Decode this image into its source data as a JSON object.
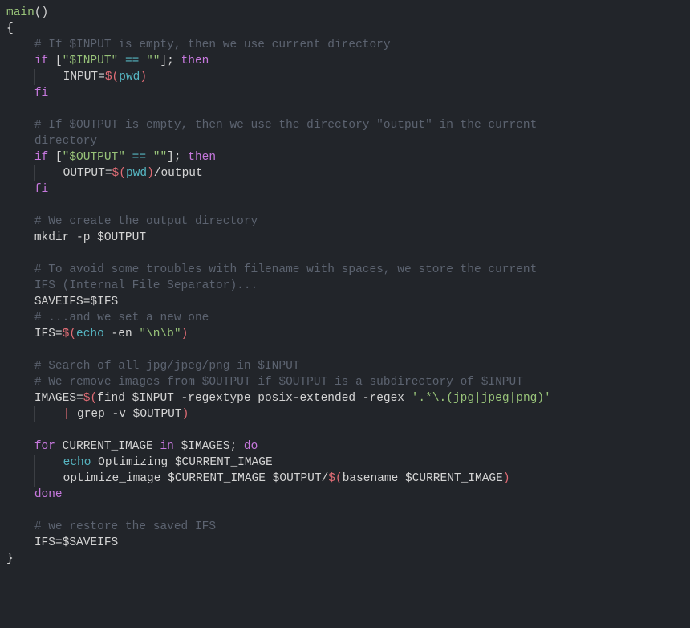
{
  "code": {
    "fn_name": "main",
    "c1": "# If $INPUT is empty, then we use current directory",
    "if": "if",
    "fi": "fi",
    "then": "then",
    "done": "done",
    "for": "for",
    "in": "in",
    "do": "do",
    "echo": "echo",
    "cond1_open": "[",
    "cond1_var": "\"$INPUT\"",
    "cond1_eq": " == ",
    "cond1_rhs": "\"\"",
    "cond1_close": "];",
    "line_input_assign_lhs": "INPUT=",
    "subst_open": "$(",
    "subst_close": ")",
    "pwd": "pwd",
    "c2a": "# If $OUTPUT is empty, then we use the directory \"output\" in the current ",
    "c2b": "directory",
    "cond2_var": "\"$OUTPUT\"",
    "line_output_assign_lhs": "OUTPUT=",
    "line_output_tail": "/output",
    "c3": "# We create the output directory",
    "mkdir": "mkdir -p $OUTPUT",
    "c4a": "# To avoid some troubles with filename with spaces, we store the current ",
    "c4b": "IFS (Internal File Separator)...",
    "saveifs": "SAVEIFS=$IFS",
    "c5": "# ...and we set a new one",
    "ifs_lhs": "IFS=",
    "ifs_flags": " -en ",
    "ifs_str": "\"\\n\\b\"",
    "c6": "# Search of all jpg/jpeg/png in $INPUT",
    "c7": "# We remove images from $OUTPUT if $OUTPUT is a subdirectory of $INPUT",
    "images_lhs": "IMAGES=",
    "find_cmd": "find $INPUT -regextype posix-extended -regex ",
    "find_regex": "'.*\\.(jpg|jpeg|png)'",
    "pipe": "|",
    "grep_cmd": " grep -v $OUTPUT",
    "for_var": "CURRENT_IMAGE",
    "for_iter": "$IMAGES",
    "semicolon": ";",
    "echo_line": " Optimizing $CURRENT_IMAGE",
    "opt_call": "optimize_image $CURRENT_IMAGE $OUTPUT/",
    "basename": "basename $CURRENT_IMAGE",
    "c8": "# we restore the saved IFS",
    "restore": "IFS=$SAVEIFS"
  }
}
